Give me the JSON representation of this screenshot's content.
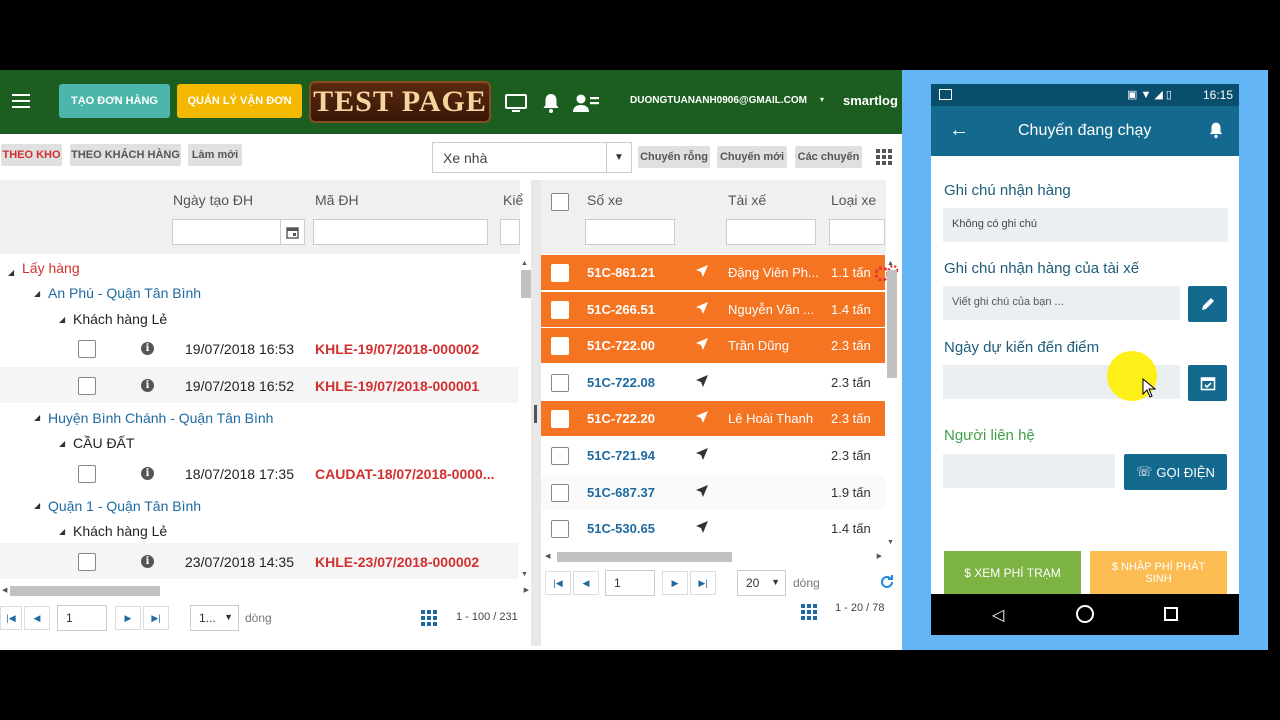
{
  "header": {
    "create_order": "TẠO ĐƠN HÀNG",
    "manage_waybill": "QUẢN LÝ VẬN ĐƠN",
    "logo_text": "TEST PAGE",
    "email": "DUONGTUANANH0906@GMAIL.COM",
    "brand": "smartlog",
    "colors": {
      "bar": "#1b5e20",
      "create": "#4db6ac",
      "manage": "#f5b800"
    }
  },
  "filters": {
    "chip_warehouse": "THEO KHO",
    "chip_customer": "THEO KHÁCH HÀNG",
    "chip_refresh": "Làm mới",
    "vehicle_select": "Xe nhà",
    "chip_empty_trip": "Chuyến rỗng",
    "chip_new_trip": "Chuyến mới",
    "chip_trips": "Các chuyến"
  },
  "orders": {
    "col_date": "Ngày tạo ĐH",
    "col_code": "Mã ĐH",
    "col_more": "Kiể",
    "group_root": "Lấy hàng",
    "groups": [
      {
        "route": "An Phú - Quận Tân Bình",
        "customer": "Khách hàng Lẻ",
        "rows": [
          {
            "date": "19/07/2018 16:53",
            "code": "KHLE-19/07/2018-000002"
          },
          {
            "date": "19/07/2018 16:52",
            "code": "KHLE-19/07/2018-000001"
          }
        ]
      },
      {
        "route": "Huyện Bình Chánh - Quận Tân Bình",
        "customer": "CẦU ĐẤT",
        "rows": [
          {
            "date": "18/07/2018 17:35",
            "code": "CAUDAT-18/07/2018-0000..."
          }
        ]
      },
      {
        "route": "Quận 1 - Quận Tân Bình",
        "customer": "Khách hàng Lẻ",
        "rows": [
          {
            "date": "23/07/2018 14:35",
            "code": "KHLE-23/07/2018-000002"
          }
        ]
      }
    ],
    "pager": {
      "page": "1",
      "size": "1...",
      "unit": "dòng",
      "range": "1 - 100 / 231"
    }
  },
  "vehicles": {
    "col_plate": "Số xe",
    "col_driver": "Tài xế",
    "col_type": "Loại xe",
    "rows": [
      {
        "plate": "51C-861.21",
        "driver": "Đặng Viên Ph...",
        "type": "1.1 tấn",
        "highlight": true
      },
      {
        "plate": "51C-266.51",
        "driver": "Nguyễn Văn ...",
        "type": "1.4 tấn",
        "highlight": true
      },
      {
        "plate": "51C-722.00",
        "driver": "Trần Dũng",
        "type": "2.3 tấn",
        "highlight": true
      },
      {
        "plate": "51C-722.08",
        "driver": "",
        "type": "2.3 tấn",
        "highlight": false
      },
      {
        "plate": "51C-722.20",
        "driver": "Lê Hoài Thanh",
        "type": "2.3 tấn",
        "highlight": true
      },
      {
        "plate": "51C-721.94",
        "driver": "",
        "type": "2.3 tấn",
        "highlight": false
      },
      {
        "plate": "51C-687.37",
        "driver": "",
        "type": "1.9 tấn",
        "highlight": false
      },
      {
        "plate": "51C-530.65",
        "driver": "",
        "type": "1.4 tấn",
        "highlight": false
      }
    ],
    "pager": {
      "page": "1",
      "size": "20",
      "unit": "dòng",
      "range": "1 - 20 / 78"
    },
    "highlight_color": "#f57422"
  },
  "phone": {
    "time": "16:15",
    "title": "Chuyến đang chạy",
    "note_label": "Ghi chú nhận hàng",
    "note_value": "Không có ghi chú",
    "driver_note_label": "Ghi chú nhận hàng của tài xế",
    "driver_note_placeholder": "Viết ghi chú của bạn ...",
    "eta_label": "Ngày dự kiến đến điểm",
    "contact_label": "Người liên hệ",
    "call_button": "GỌI ĐIỆN",
    "fee_button": "$ XEM PHÍ TRẠM",
    "extra_fee_button": "$ NHẬP PHÍ PHÁT SINH"
  }
}
